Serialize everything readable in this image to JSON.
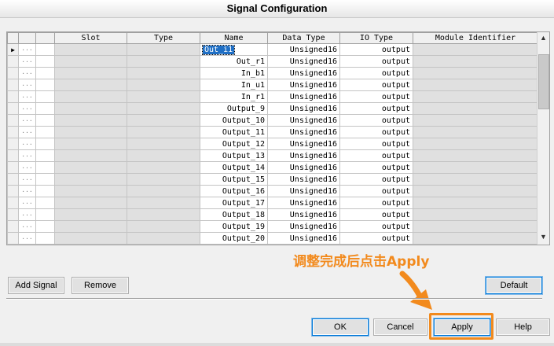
{
  "window": {
    "title": "Signal Configuration"
  },
  "grid": {
    "columns": [
      "",
      "",
      "Slot",
      "Type",
      "Name",
      "Data Type",
      "IO Type",
      "Module Identifier"
    ],
    "rows": [
      {
        "marker": "▶",
        "tree": "···",
        "slot": "",
        "type": "",
        "name": "Out_i1",
        "data_type": "Unsigned16",
        "io_type": "output",
        "module": "",
        "selected": true
      },
      {
        "marker": "",
        "tree": "···",
        "slot": "",
        "type": "",
        "name": "Out_r1",
        "data_type": "Unsigned16",
        "io_type": "output",
        "module": ""
      },
      {
        "marker": "",
        "tree": "···",
        "slot": "",
        "type": "",
        "name": "In_b1",
        "data_type": "Unsigned16",
        "io_type": "output",
        "module": ""
      },
      {
        "marker": "",
        "tree": "···",
        "slot": "",
        "type": "",
        "name": "In_u1",
        "data_type": "Unsigned16",
        "io_type": "output",
        "module": ""
      },
      {
        "marker": "",
        "tree": "···",
        "slot": "",
        "type": "",
        "name": "In_r1",
        "data_type": "Unsigned16",
        "io_type": "output",
        "module": ""
      },
      {
        "marker": "",
        "tree": "···",
        "slot": "",
        "type": "",
        "name": "Output_9",
        "data_type": "Unsigned16",
        "io_type": "output",
        "module": ""
      },
      {
        "marker": "",
        "tree": "···",
        "slot": "",
        "type": "",
        "name": "Output_10",
        "data_type": "Unsigned16",
        "io_type": "output",
        "module": ""
      },
      {
        "marker": "",
        "tree": "···",
        "slot": "",
        "type": "",
        "name": "Output_11",
        "data_type": "Unsigned16",
        "io_type": "output",
        "module": ""
      },
      {
        "marker": "",
        "tree": "···",
        "slot": "",
        "type": "",
        "name": "Output_12",
        "data_type": "Unsigned16",
        "io_type": "output",
        "module": ""
      },
      {
        "marker": "",
        "tree": "···",
        "slot": "",
        "type": "",
        "name": "Output_13",
        "data_type": "Unsigned16",
        "io_type": "output",
        "module": ""
      },
      {
        "marker": "",
        "tree": "···",
        "slot": "",
        "type": "",
        "name": "Output_14",
        "data_type": "Unsigned16",
        "io_type": "output",
        "module": ""
      },
      {
        "marker": "",
        "tree": "···",
        "slot": "",
        "type": "",
        "name": "Output_15",
        "data_type": "Unsigned16",
        "io_type": "output",
        "module": ""
      },
      {
        "marker": "",
        "tree": "···",
        "slot": "",
        "type": "",
        "name": "Output_16",
        "data_type": "Unsigned16",
        "io_type": "output",
        "module": ""
      },
      {
        "marker": "",
        "tree": "···",
        "slot": "",
        "type": "",
        "name": "Output_17",
        "data_type": "Unsigned16",
        "io_type": "output",
        "module": ""
      },
      {
        "marker": "",
        "tree": "···",
        "slot": "",
        "type": "",
        "name": "Output_18",
        "data_type": "Unsigned16",
        "io_type": "output",
        "module": ""
      },
      {
        "marker": "",
        "tree": "···",
        "slot": "",
        "type": "",
        "name": "Output_19",
        "data_type": "Unsigned16",
        "io_type": "output",
        "module": ""
      },
      {
        "marker": "",
        "tree": "···",
        "slot": "",
        "type": "",
        "name": "Output_20",
        "data_type": "Unsigned16",
        "io_type": "output",
        "module": ""
      }
    ],
    "scroll_up_icon": "chevron-up-icon",
    "scroll_down_icon": "chevron-down-icon"
  },
  "buttons": {
    "add_signal": "Add Signal",
    "remove": "Remove",
    "default": "Default",
    "ok": "OK",
    "cancel": "Cancel",
    "apply": "Apply",
    "help": "Help"
  },
  "annotation": {
    "text": "调整完成后点击Apply",
    "color": "#f28a1d",
    "arrow_icon": "arrow-right-down-icon"
  },
  "colors": {
    "selection": "#1f6fc5",
    "focus_border": "#0078d7",
    "readonly_cell": "#e0e0e0"
  }
}
